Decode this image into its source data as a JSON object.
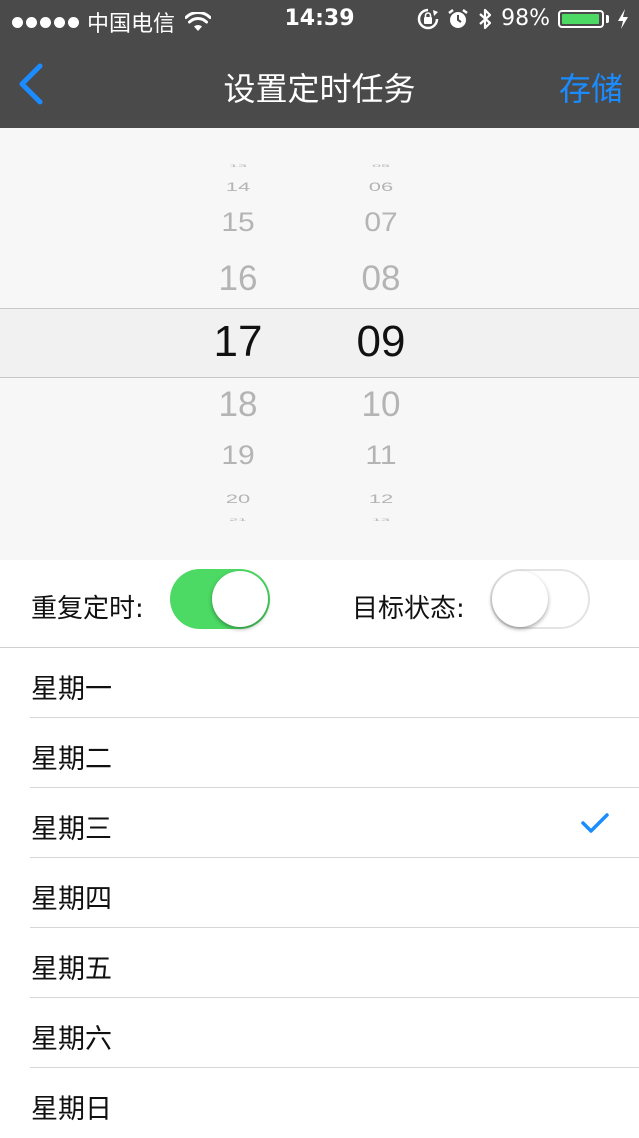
{
  "status_bar": {
    "carrier": "中国电信",
    "time": "14:39",
    "battery_text": "98%",
    "battery_level": 0.98,
    "battery_color": "#4cd964",
    "icons": [
      "signal-dots-icon",
      "wifi-icon",
      "rotation-lock-icon",
      "alarm-icon",
      "bluetooth-icon",
      "battery-icon",
      "charging-icon"
    ]
  },
  "nav": {
    "title": "设置定时任务",
    "save_label": "存储",
    "back_icon": "chevron-left-icon",
    "accent": "#1a8cff"
  },
  "picker": {
    "hours": [
      "13",
      "14",
      "15",
      "16",
      "17",
      "18",
      "19",
      "20",
      "21"
    ],
    "minutes": [
      "05",
      "06",
      "07",
      "08",
      "09",
      "10",
      "11",
      "12",
      "13"
    ],
    "selected_hour": "17",
    "selected_minute": "09"
  },
  "toggles": {
    "repeat_label": "重复定时:",
    "repeat_on": true,
    "target_label": "目标状态:",
    "target_on": false,
    "on_color": "#4cd964"
  },
  "days": [
    {
      "label": "星期一",
      "checked": false
    },
    {
      "label": "星期二",
      "checked": false
    },
    {
      "label": "星期三",
      "checked": true
    },
    {
      "label": "星期四",
      "checked": false
    },
    {
      "label": "星期五",
      "checked": false
    },
    {
      "label": "星期六",
      "checked": false
    },
    {
      "label": "星期日",
      "checked": false
    }
  ]
}
